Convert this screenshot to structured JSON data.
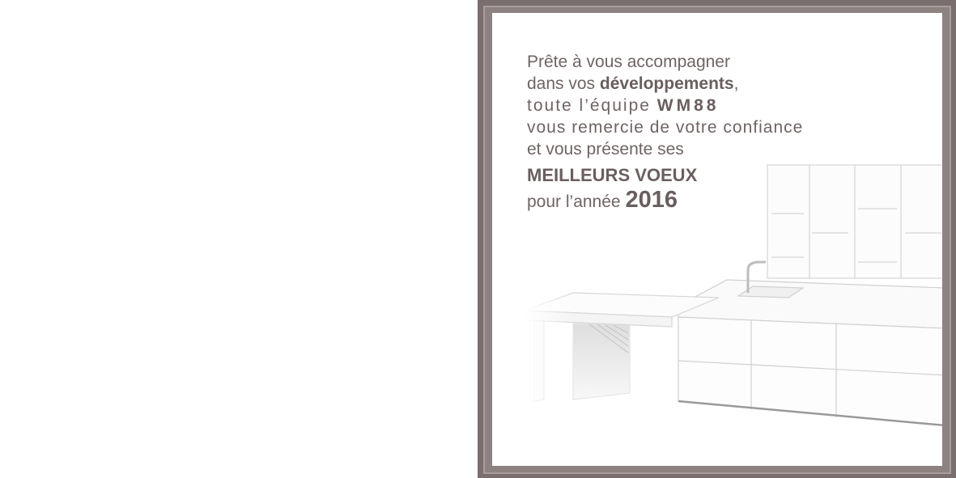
{
  "card": {
    "line1": "Prête à vous accompagner",
    "line2_prefix": "dans vos ",
    "line2_bold": "développements",
    "line2_suffix": ",",
    "line3_prefix": "toute l’équipe ",
    "line3_company": "WM88",
    "line4": "vous remercie de votre confiance",
    "line5": "et vous présente ses",
    "line6": "MEILLEURS VOEUX",
    "line7_prefix": "pour l’année ",
    "line7_year": "2016"
  },
  "colors": {
    "frame": "#7a6e6e",
    "text": "#6f6464",
    "background": "#ffffff"
  }
}
